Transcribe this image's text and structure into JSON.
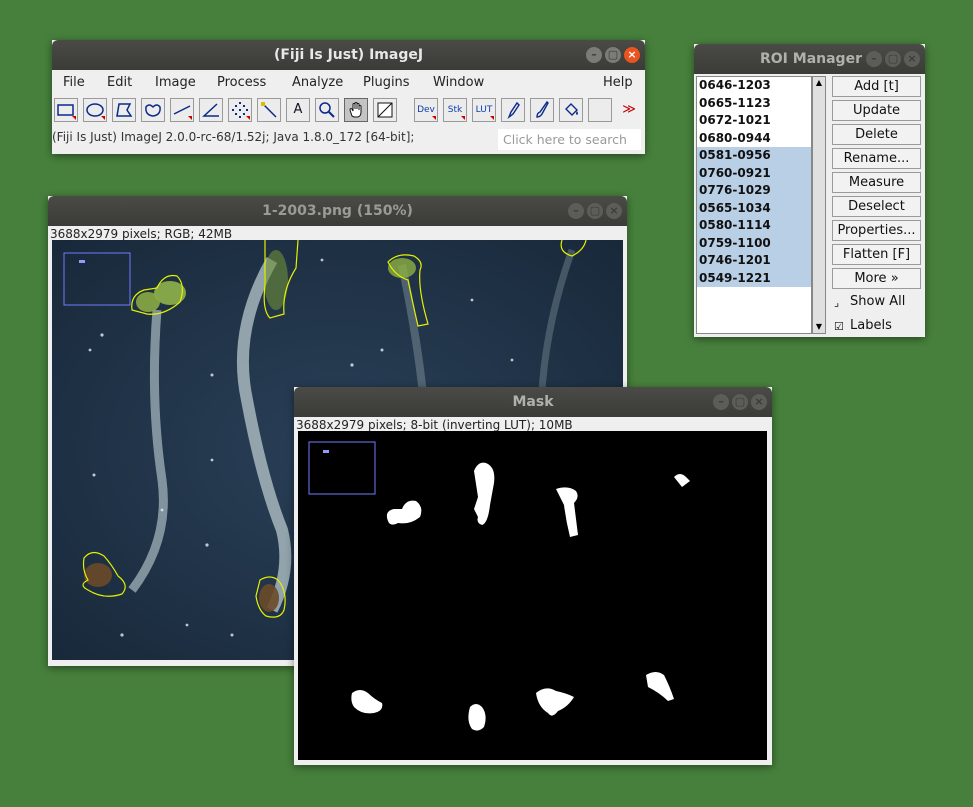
{
  "imagej": {
    "title": "(Fiji Is Just) ImageJ",
    "menus": [
      "File",
      "Edit",
      "Image",
      "Process",
      "Analyze",
      "Plugins",
      "Window",
      "Help"
    ],
    "tools": {
      "text": "A",
      "dev": "Dev",
      "stk": "Stk",
      "lut": "LUT",
      "more": "≫"
    },
    "status": "(Fiji Is Just) ImageJ 2.0.0-rc-68/1.52j; Java 1.8.0_172 [64-bit];",
    "search_placeholder": "Click here to search"
  },
  "image_window": {
    "title": "1-2003.png (150%)",
    "info": "3688x2979 pixels; RGB; 42MB"
  },
  "mask_window": {
    "title": "Mask",
    "info": "3688x2979 pixels; 8-bit (inverting LUT); 10MB"
  },
  "roi_manager": {
    "title": "ROI Manager",
    "items": [
      {
        "label": "0646-1203",
        "selected": false
      },
      {
        "label": "0665-1123",
        "selected": false
      },
      {
        "label": "0672-1021",
        "selected": false
      },
      {
        "label": "0680-0944",
        "selected": false
      },
      {
        "label": "0581-0956",
        "selected": true
      },
      {
        "label": "0760-0921",
        "selected": true
      },
      {
        "label": "0776-1029",
        "selected": true
      },
      {
        "label": "0565-1034",
        "selected": true
      },
      {
        "label": "0580-1114",
        "selected": true
      },
      {
        "label": "0759-1100",
        "selected": true
      },
      {
        "label": "0746-1201",
        "selected": true
      },
      {
        "label": "0549-1221",
        "selected": true
      }
    ],
    "buttons": [
      "Add [t]",
      "Update",
      "Delete",
      "Rename...",
      "Measure",
      "Deselect",
      "Properties...",
      "Flatten [F]",
      "More »"
    ],
    "show_all": {
      "label": "Show All",
      "checked": false
    },
    "labels": {
      "label": "Labels",
      "checked": true
    }
  },
  "colors": {
    "desktop": "#47803c",
    "titlebar": "#3b3b38",
    "close": "#e95420",
    "roi_outline": "#e5f000",
    "selection": "#b8cfe6"
  }
}
